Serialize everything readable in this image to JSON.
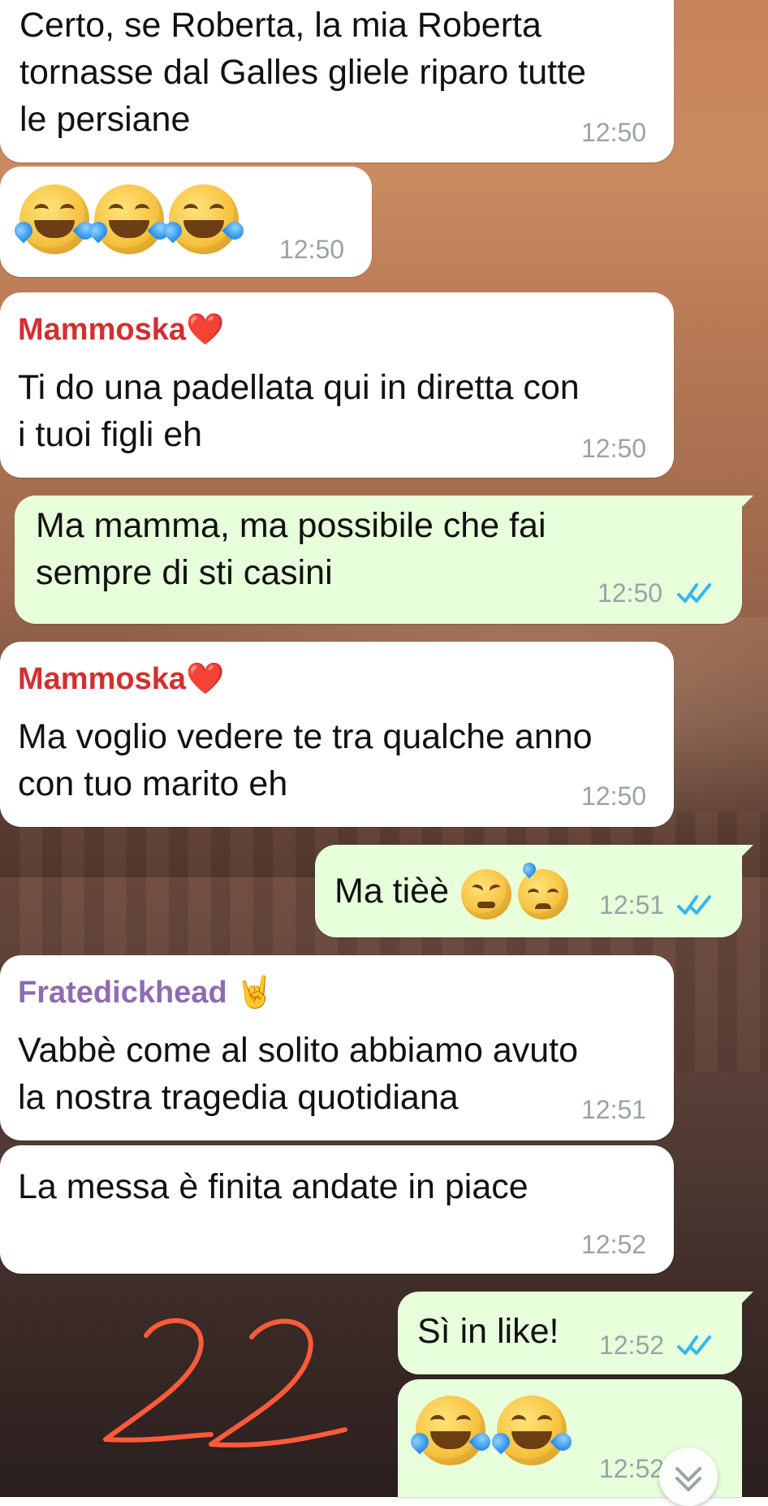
{
  "chat": {
    "colors": {
      "incoming_bubble": "#ffffff",
      "outgoing_bubble": "#e7ffdb",
      "timestamp": "#9aa3a6",
      "read_ticks": "#34b7f1",
      "sender_mammoska": "#d32f2f",
      "sender_fratedickhead": "#8e6bb2",
      "handwritten_mark": "#ff5b3b"
    },
    "messages": [
      {
        "direction": "incoming",
        "text": "Certo, se Roberta, la mia Roberta\ntornasse dal Galles gliele riparo tutte\nle persiane",
        "time": "12:50"
      },
      {
        "direction": "incoming",
        "text": "😂😂😂",
        "time": "12:50"
      },
      {
        "direction": "incoming",
        "sender": "Mammoska❤️",
        "text": "Ti do una padellata qui in diretta con\ni tuoi figli eh",
        "time": "12:50"
      },
      {
        "direction": "outgoing",
        "text": "Ma mamma, ma possibile che fai\nsempre di sti casini",
        "time": "12:50",
        "status": "read"
      },
      {
        "direction": "incoming",
        "sender": "Mammoska❤️",
        "text": "Ma voglio vedere te tra qualche anno\ncon tuo marito eh",
        "time": "12:50"
      },
      {
        "direction": "outgoing",
        "text": "Ma tièè😣😓",
        "time": "12:51",
        "status": "read"
      },
      {
        "direction": "incoming",
        "sender": "Fratedickhead 🤘",
        "text": "Vabbè come al solito abbiamo avuto\nla nostra tragedia quotidiana",
        "time": "12:51"
      },
      {
        "direction": "incoming",
        "text": "La messa è finita andate in piace",
        "time": "12:52"
      },
      {
        "direction": "outgoing",
        "text": "Sì in like!",
        "time": "12:52",
        "status": "read"
      },
      {
        "direction": "outgoing",
        "text": "😂😂",
        "time": "12:52",
        "status": "read"
      }
    ],
    "overlay": {
      "handwritten_text": "22"
    },
    "icons": {
      "read_receipt": "double-check-icon",
      "scroll_down": "chevron-double-down-icon",
      "sender_heart": "red-heart-icon",
      "sender_rock": "rock-hand-icon",
      "laughing_tears": "face-with-tears-of-joy-icon",
      "persevering": "persevering-face-icon",
      "sweat": "downcast-face-with-sweat-icon"
    }
  }
}
